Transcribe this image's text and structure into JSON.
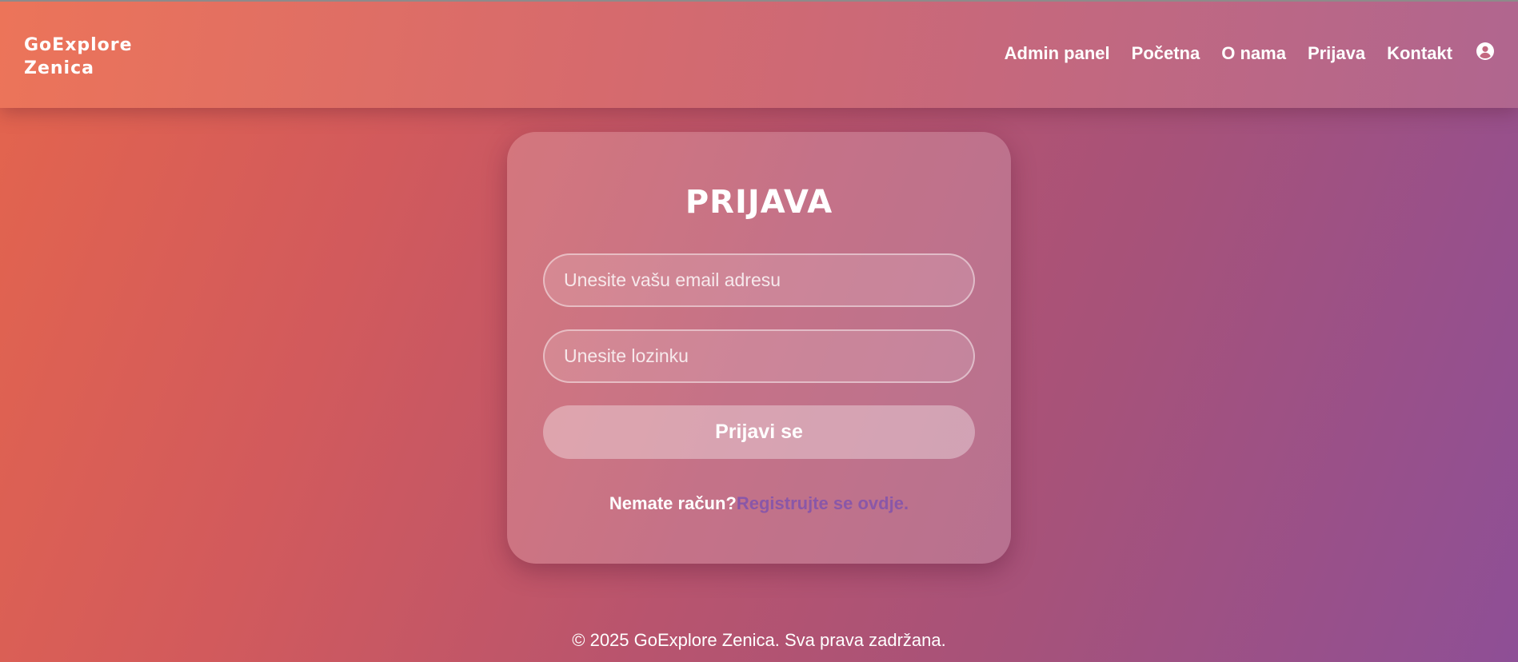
{
  "brand": {
    "line1": "GoExplore",
    "line2": "Zenica"
  },
  "nav": {
    "items": [
      {
        "label": "Admin panel"
      },
      {
        "label": "Početna"
      },
      {
        "label": "O nama"
      },
      {
        "label": "Prijava"
      },
      {
        "label": "Kontakt"
      }
    ],
    "user_icon": "user-circle-icon"
  },
  "login": {
    "title": "PRIJAVA",
    "email": {
      "value": "",
      "placeholder": "Unesite vašu email adresu"
    },
    "password": {
      "value": "",
      "placeholder": "Unesite lozinku"
    },
    "submit_label": "Prijavi se",
    "register_question": "Nemate račun?",
    "register_link": "Registrujte se ovdje."
  },
  "footer": {
    "text": "© 2025 GoExplore Zenica. Sva prava zadržana."
  },
  "colors": {
    "gradient_start": "#e4654d",
    "gradient_end": "#8e4f96",
    "link_accent": "#8a57a8",
    "text": "#ffffff"
  }
}
